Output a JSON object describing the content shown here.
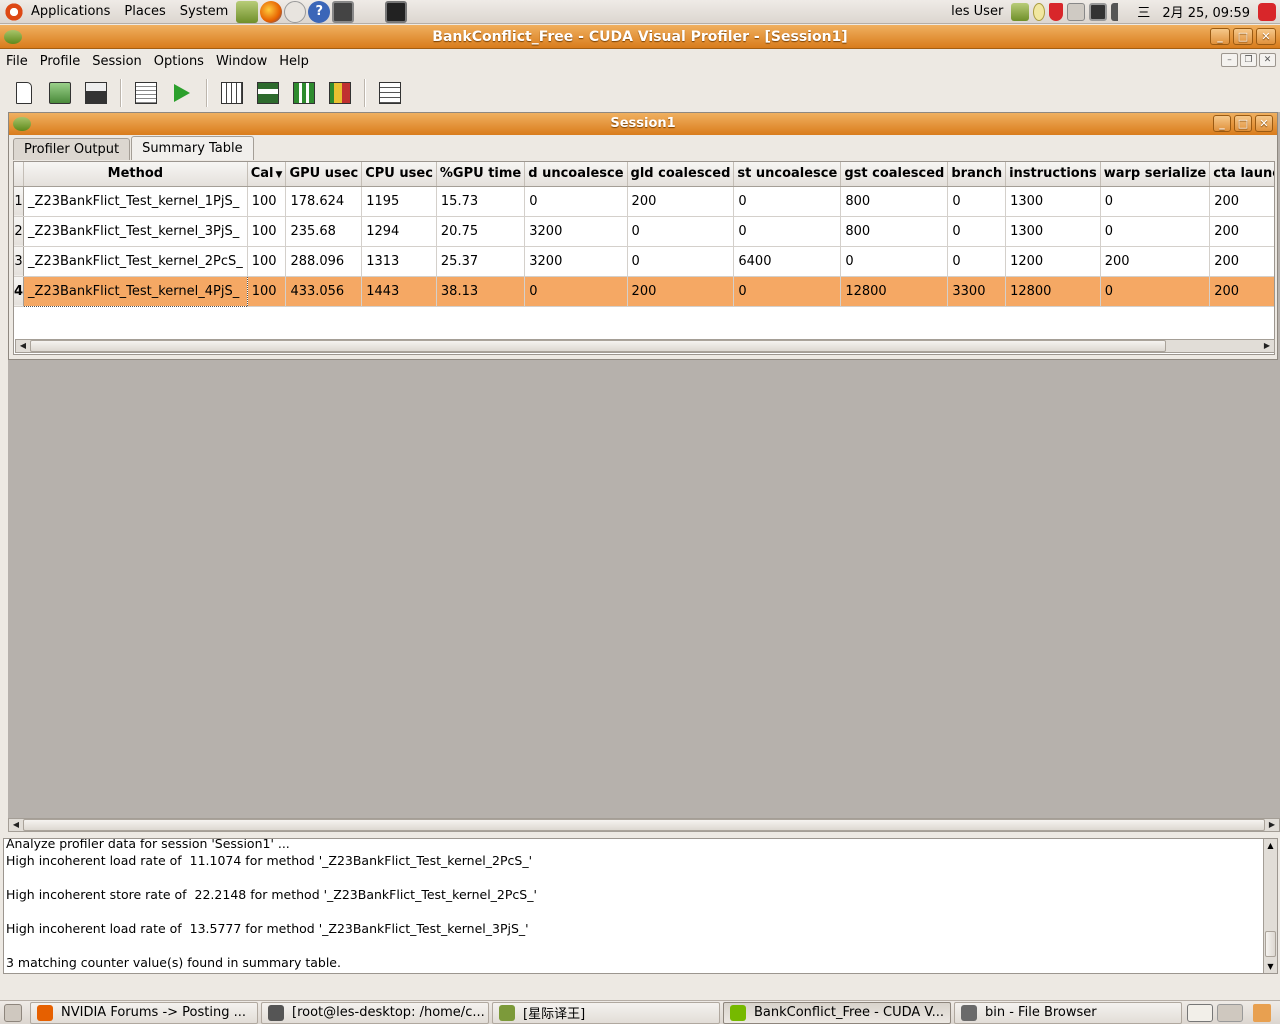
{
  "top_panel": {
    "menus": [
      "Applications",
      "Places",
      "System"
    ],
    "user": "les User",
    "clock": "2月 25, 09:59",
    "ime_char": "三"
  },
  "window": {
    "title": "BankConflict_Free - CUDA Visual Profiler - [Session1]",
    "menubar": [
      "File",
      "Profile",
      "Session",
      "Options",
      "Window",
      "Help"
    ]
  },
  "session": {
    "title": "Session1",
    "tabs": [
      "Profiler Output",
      "Summary Table"
    ],
    "active_tab": "Summary Table"
  },
  "summary_table": {
    "columns": [
      "Method",
      "Cal",
      "GPU usec",
      "CPU usec",
      "%GPU time",
      "d uncoalesce",
      "gld coalesced",
      "st uncoalesce",
      "gst coalesced",
      "branch",
      "instructions",
      "warp serialize",
      "cta launched"
    ],
    "rows": [
      {
        "num": "1",
        "cells": [
          "_Z23BankFlict_Test_kernel_1PjS_",
          "100",
          "178.624",
          "1195",
          "15.73",
          "0",
          "200",
          "0",
          "800",
          "0",
          "1300",
          "0",
          "200"
        ]
      },
      {
        "num": "2",
        "cells": [
          "_Z23BankFlict_Test_kernel_3PjS_",
          "100",
          "235.68",
          "1294",
          "20.75",
          "3200",
          "0",
          "0",
          "800",
          "0",
          "1300",
          "0",
          "200"
        ]
      },
      {
        "num": "3",
        "cells": [
          "_Z23BankFlict_Test_kernel_2PcS_",
          "100",
          "288.096",
          "1313",
          "25.37",
          "3200",
          "0",
          "6400",
          "0",
          "0",
          "1200",
          "200",
          "200"
        ]
      },
      {
        "num": "4",
        "cells": [
          "_Z23BankFlict_Test_kernel_4PjS_",
          "100",
          "433.056",
          "1443",
          "38.13",
          "0",
          "200",
          "0",
          "12800",
          "3300",
          "12800",
          "0",
          "200"
        ]
      }
    ],
    "selected_row": 3
  },
  "log_lines": [
    "Analyze profiler data for session 'Session1' ...",
    "High incoherent load rate of  11.1074 for method '_Z23BankFlict_Test_kernel_2PcS_'",
    "",
    "High incoherent store rate of  22.2148 for method '_Z23BankFlict_Test_kernel_2PcS_'",
    "",
    "High incoherent load rate of  13.5777 for method '_Z23BankFlict_Test_kernel_3PjS_'",
    "",
    "3 matching counter value(s) found in summary table."
  ],
  "taskbar": [
    {
      "label": "NVIDIA Forums -> Posting ...",
      "icon": "firefox-icon",
      "color": "#e66000"
    },
    {
      "label": "[root@les-desktop: /home/c...",
      "icon": "terminal-icon",
      "color": "#555555"
    },
    {
      "label": "[星际译王]",
      "icon": "stardict-icon",
      "color": "#7c9a3a"
    },
    {
      "label": "BankConflict_Free - CUDA V...",
      "icon": "nvidia-icon",
      "color": "#76b900",
      "active": true
    },
    {
      "label": "bin - File Browser",
      "icon": "folder-icon",
      "color": "#6a6a6a"
    }
  ],
  "colors": {
    "accent": "#e08a2c",
    "selected_row": "#f5a864"
  }
}
